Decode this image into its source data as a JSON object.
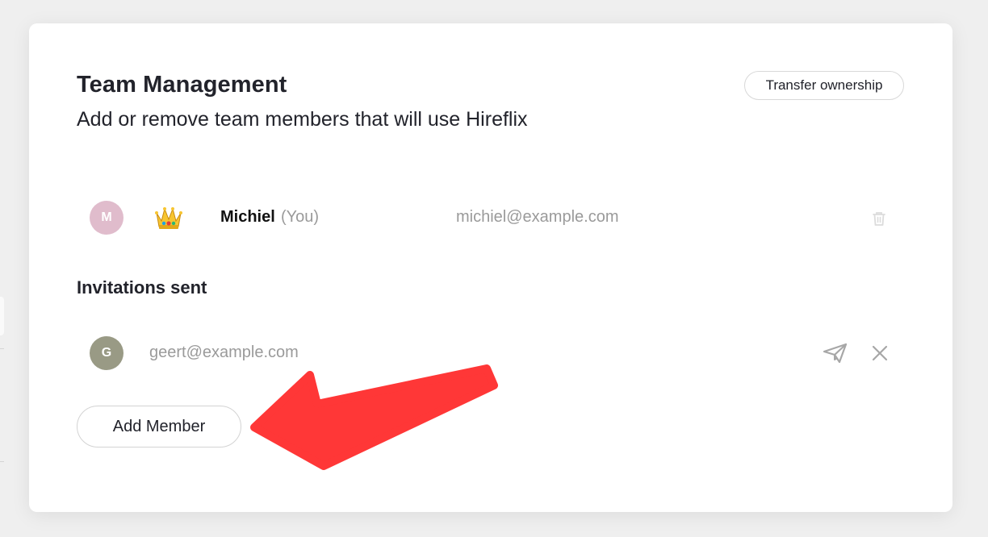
{
  "header": {
    "title": "Team Management",
    "subtitle": "Add or remove team members that will use Hireflix",
    "transfer_button": "Transfer ownership"
  },
  "members": [
    {
      "initial": "M",
      "name": "Michiel",
      "suffix": "(You)",
      "email": "michiel@example.com",
      "role_icon": "crown-icon",
      "avatar_color": "#e0bccc"
    }
  ],
  "invitations": {
    "title": "Invitations sent",
    "items": [
      {
        "initial": "G",
        "email": "geert@example.com",
        "avatar_color": "#999a85"
      }
    ]
  },
  "actions": {
    "add_member_button": "Add Member"
  },
  "colors": {
    "annotation_arrow": "#ff3737",
    "muted_text": "#9a9a9a",
    "heading_text": "#22232b"
  },
  "icons": {
    "trash": "trash-icon",
    "resend": "send-icon",
    "revoke": "close-icon"
  }
}
